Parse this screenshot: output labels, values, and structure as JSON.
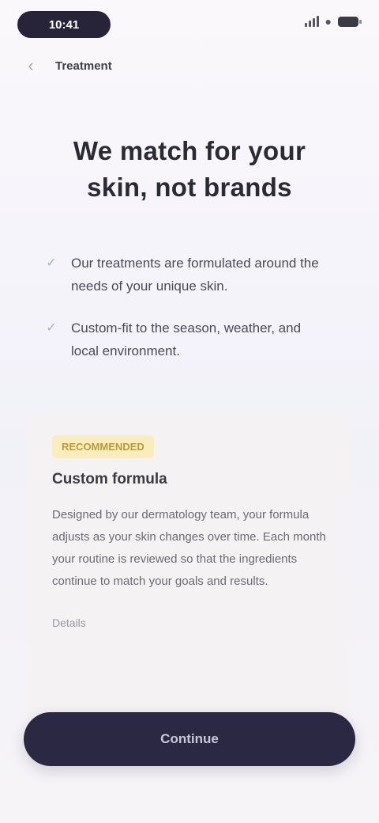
{
  "status_bar": {
    "time": "10:41"
  },
  "header": {
    "back_icon": "chevron-left-icon",
    "title": "Treatment"
  },
  "hero": {
    "title": "We match for your skin, not brands"
  },
  "features": [
    {
      "icon": "check-icon",
      "text": "Our treatments are formulated around the needs of your unique skin."
    },
    {
      "icon": "check-icon",
      "text": "Custom-fit to the season, weather, and local environment."
    }
  ],
  "card": {
    "badge": "RECOMMENDED",
    "title": "Custom formula",
    "body": "Designed by our dermatology team, your formula adjusts as your skin changes over time. Each month your routine is reviewed so that the ingredients continue to match your goals and results.",
    "note": "Details"
  },
  "cta": {
    "label": "Continue"
  },
  "colors": {
    "cta_background": "#2a2842",
    "badge_background": "#f9edbe",
    "check_accent": "#a9b0d8"
  }
}
